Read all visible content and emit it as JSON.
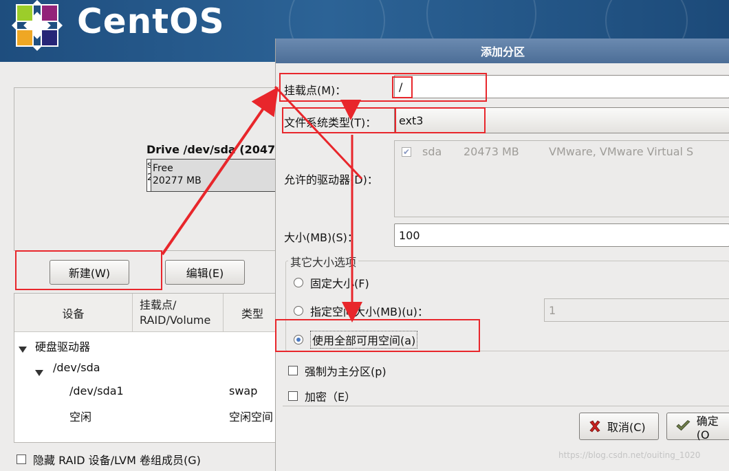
{
  "banner": {
    "brand": "CentOS"
  },
  "main": {
    "drive_title": "Drive /dev/sda (2047",
    "drive_segment_label": "s\n2",
    "drive_free_label": "Free",
    "drive_free_size": "20277 MB",
    "new_button": "新建(W)",
    "edit_button": "编辑(E)",
    "table": {
      "col_device": "设备",
      "col_mount": "挂载点/\nRAID/Volume",
      "col_type": "类型",
      "rows": [
        {
          "device": "硬盘驱动器",
          "mount": "",
          "type": ""
        },
        {
          "device": "/dev/sda",
          "mount": "",
          "type": ""
        },
        {
          "device": "/dev/sda1",
          "mount": "",
          "type": "swap"
        },
        {
          "device": "空闲",
          "mount": "",
          "type": "空闲空间"
        }
      ]
    },
    "hide_raid_label": "隐藏 RAID 设备/LVM 卷组成员(G)"
  },
  "dialog": {
    "title": "添加分区",
    "mount_label": "挂载点(M)：",
    "mount_value": "/",
    "fstype_label": "文件系统类型(T)：",
    "fstype_value": "ext3",
    "allowed_drives_label": "允许的驱动器(D)：",
    "drive_row": {
      "name": "sda",
      "size": "20473 MB",
      "model": "VMware, VMware Virtual S"
    },
    "size_label": "大小(MB)(S)：",
    "size_value": "100",
    "other_size_group": "其它大小选项",
    "opt_fixed": "固定大小(F)",
    "opt_upto": "指定空间大小(MB)(u)：",
    "opt_upto_value": "1",
    "opt_fill": "使用全部可用空间(a)",
    "force_primary": "强制为主分区(p)",
    "encrypt": "加密（E）",
    "cancel_button": "取消(C)",
    "ok_button": "确定(O"
  },
  "watermark": "https://blog.csdn.net/ouiting_1020",
  "colors": {
    "banner": "#2c6396",
    "dialog_title": "#5a7ba3",
    "annotation_red": "#e8262b",
    "radio_selected": "#4b7ac2"
  }
}
